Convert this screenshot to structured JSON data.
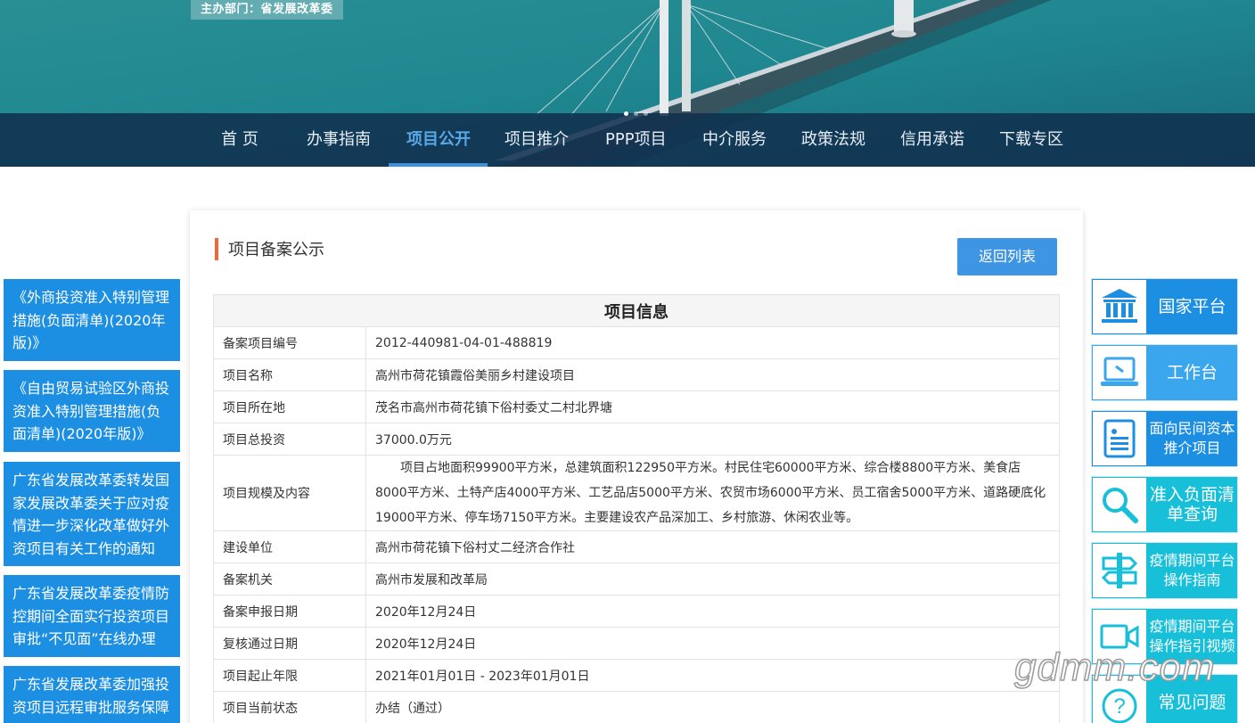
{
  "banner": {
    "sponsor": "主办部门：省发展改革委"
  },
  "nav": {
    "items": [
      {
        "label": "首 页"
      },
      {
        "label": "办事指南"
      },
      {
        "label": "项目公开"
      },
      {
        "label": "项目推介"
      },
      {
        "label": "PPP项目"
      },
      {
        "label": "中介服务"
      },
      {
        "label": "政策法规"
      },
      {
        "label": "信用承诺"
      },
      {
        "label": "下载专区"
      }
    ],
    "active_index": 2
  },
  "left_links": [
    {
      "text": "《外商投资准入特别管理措施(负面清单)(2020年版)》"
    },
    {
      "text": "《自由贸易试验区外商投资准入特别管理措施(负面清单)(2020年版)》"
    },
    {
      "text": "广东省发展改革委转发国家发展改革委关于应对疫情进一步深化改革做好外资项目有关工作的通知"
    },
    {
      "text": "广东省发展改革委疫情防控期间全面实行投资项目审批“不见面”在线办理"
    },
    {
      "text": "广东省发展改革委加强投资项目远程审批服务保障"
    }
  ],
  "main": {
    "title": "项目备案公示",
    "back_label": "返回列表",
    "table_title": "项目信息",
    "rows": [
      {
        "label": "备案项目编号",
        "value": "2012-440981-04-01-488819"
      },
      {
        "label": "项目名称",
        "value": "高州市荷花镇霞俗美丽乡村建设项目"
      },
      {
        "label": "项目所在地",
        "value": "茂名市高州市荷花镇下俗村委丈二村北界塘"
      },
      {
        "label": "项目总投资",
        "value": "37000.0万元"
      },
      {
        "label": "项目规模及内容",
        "value": "项目占地面积99900平方米，总建筑面积122950平方米。村民住宅60000平方米、综合楼8800平方米、美食店8000平方米、土特产店4000平方米、工艺品店5000平方米、农贸市场6000平方米、员工宿舍5000平方米、道路硬底化19000平方米、停车场7150平方米。主要建设农产品深加工、乡村旅游、休闲农业等。"
      },
      {
        "label": "建设单位",
        "value": "高州市荷花镇下俗村丈二经济合作社"
      },
      {
        "label": "备案机关",
        "value": "高州市发展和改革局"
      },
      {
        "label": "备案申报日期",
        "value": "2020年12月24日"
      },
      {
        "label": "复核通过日期",
        "value": "2020年12月24日"
      },
      {
        "label": "项目起止年限",
        "value": "2021年01月01日 - 2023年01月01日"
      },
      {
        "label": "项目当前状态",
        "value": "办结（通过）"
      }
    ]
  },
  "tiles": [
    {
      "label": "国家平台",
      "icon": "government-building-icon",
      "color": "#1d8fe3"
    },
    {
      "label": "工作台",
      "icon": "laptop-icon",
      "color": "#3aa6ee"
    },
    {
      "label": "面向民间资本推介项目",
      "icon": "document-list-icon",
      "color": "#1d8fe3"
    },
    {
      "label": "准入负面清单查询",
      "icon": "search-icon",
      "color": "#17bfd9"
    },
    {
      "label": "疫情期间平台操作指南",
      "icon": "signpost-icon",
      "color": "#17bfd9"
    },
    {
      "label": "疫情期间平台操作指引视频",
      "icon": "video-camera-icon",
      "color": "#17bfd9"
    },
    {
      "label": "常见问题",
      "icon": "question-icon",
      "color": "#17bfd9"
    }
  ],
  "watermark": "gdmm.com",
  "colors": {
    "accent": "#1d8fe3",
    "teal": "#17bfd9",
    "title_bar": "#f0673a",
    "nav_bg": "#102e4e"
  }
}
